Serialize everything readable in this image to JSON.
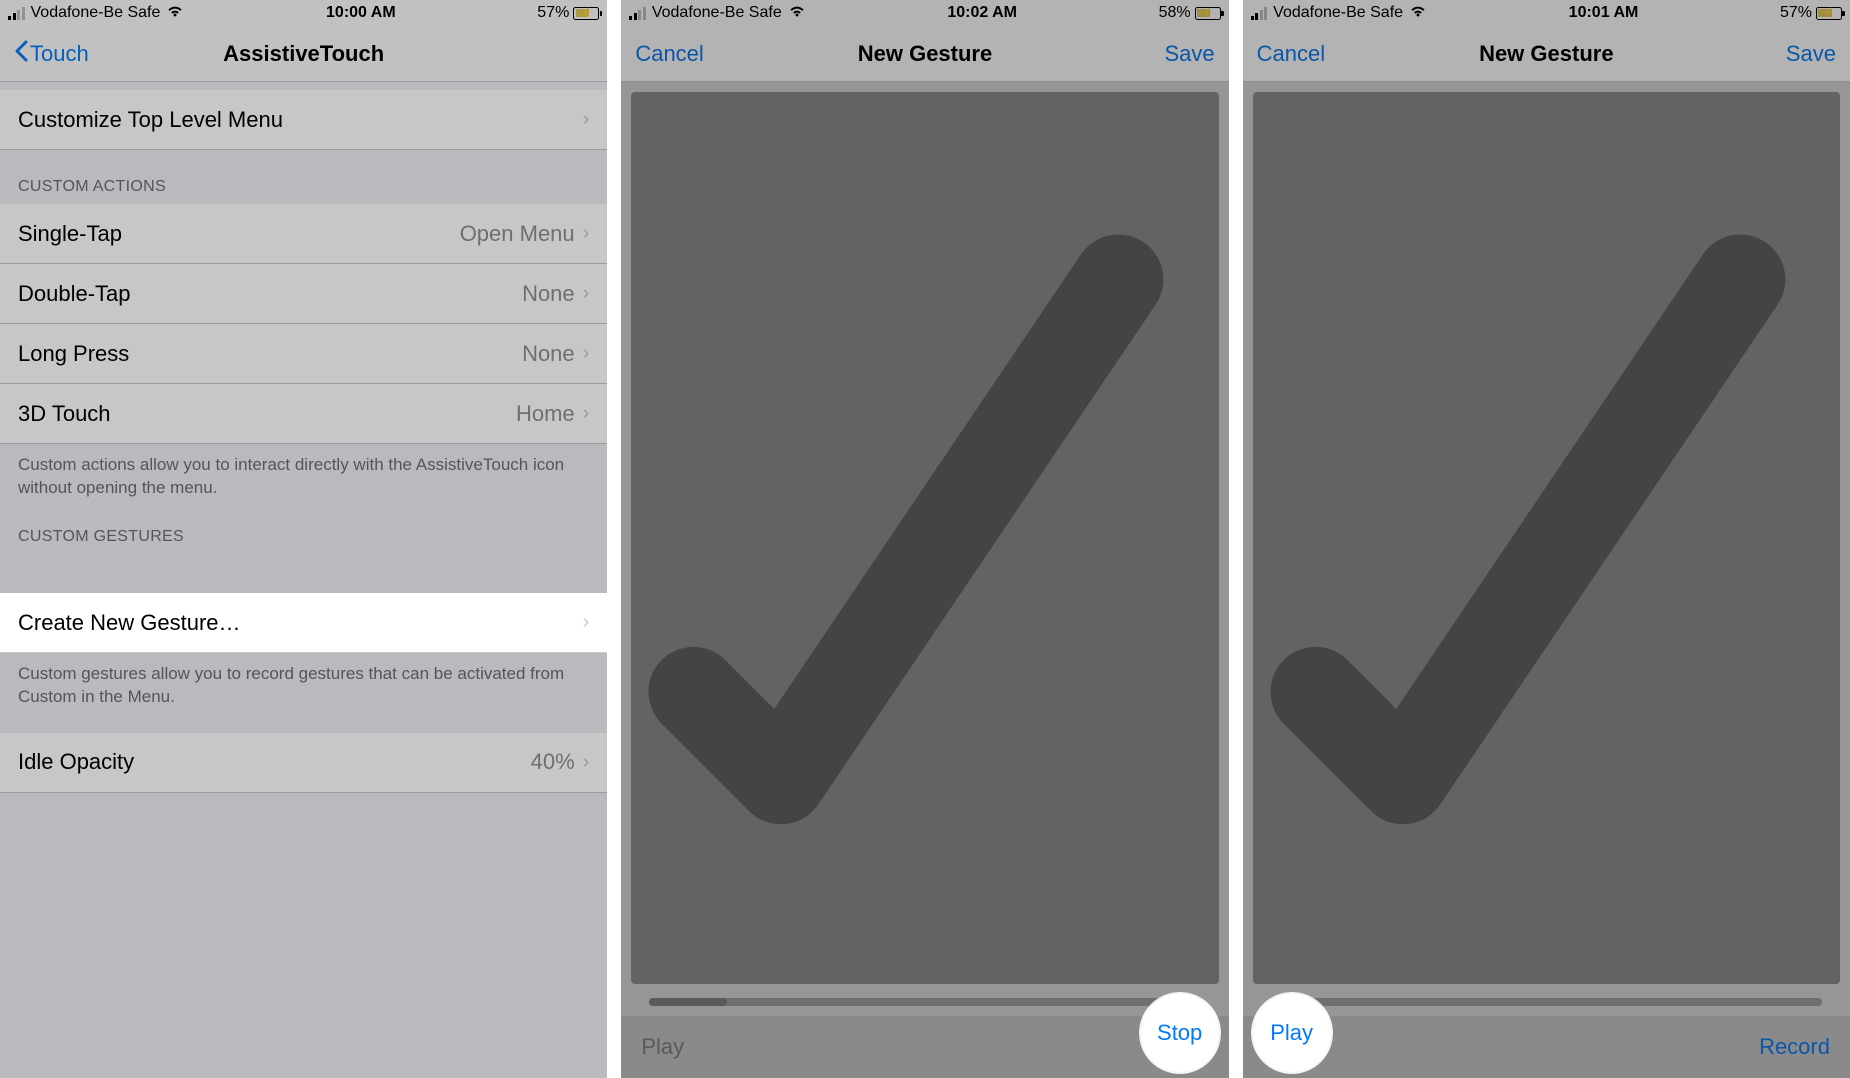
{
  "panel1": {
    "status": {
      "carrier": "Vodafone-Be Safe",
      "time": "10:00 AM",
      "battery_pct": "57%"
    },
    "nav": {
      "back_label": "Touch",
      "title": "AssistiveTouch"
    },
    "rows": {
      "customize": "Customize Top Level Menu",
      "section_actions": "CUSTOM ACTIONS",
      "single_tap": "Single-Tap",
      "single_tap_val": "Open Menu",
      "double_tap": "Double-Tap",
      "double_tap_val": "None",
      "long_press": "Long Press",
      "long_press_val": "None",
      "three_d_touch": "3D Touch",
      "three_d_touch_val": "Home",
      "footer_actions": "Custom actions allow you to interact directly with the AssistiveTouch icon without opening the menu.",
      "section_gestures": "CUSTOM GESTURES",
      "create_gesture": "Create New Gesture…",
      "footer_gestures": "Custom gestures allow you to record gestures that can be activated from Custom in the Menu.",
      "idle_opacity": "Idle Opacity",
      "idle_opacity_val": "40%"
    }
  },
  "panel2": {
    "status": {
      "carrier": "Vodafone-Be Safe",
      "time": "10:02 AM",
      "battery_pct": "58%"
    },
    "nav": {
      "cancel": "Cancel",
      "title": "New Gesture",
      "save": "Save"
    },
    "toolbar": {
      "play": "Play",
      "stop": "Stop"
    },
    "highlight": "Stop",
    "progress_pct": 14
  },
  "panel3": {
    "status": {
      "carrier": "Vodafone-Be Safe",
      "time": "10:01 AM",
      "battery_pct": "57%"
    },
    "nav": {
      "cancel": "Cancel",
      "title": "New Gesture",
      "save": "Save"
    },
    "toolbar": {
      "play": "Play",
      "record": "Record"
    },
    "highlight": "Play",
    "progress_pct": 0
  }
}
